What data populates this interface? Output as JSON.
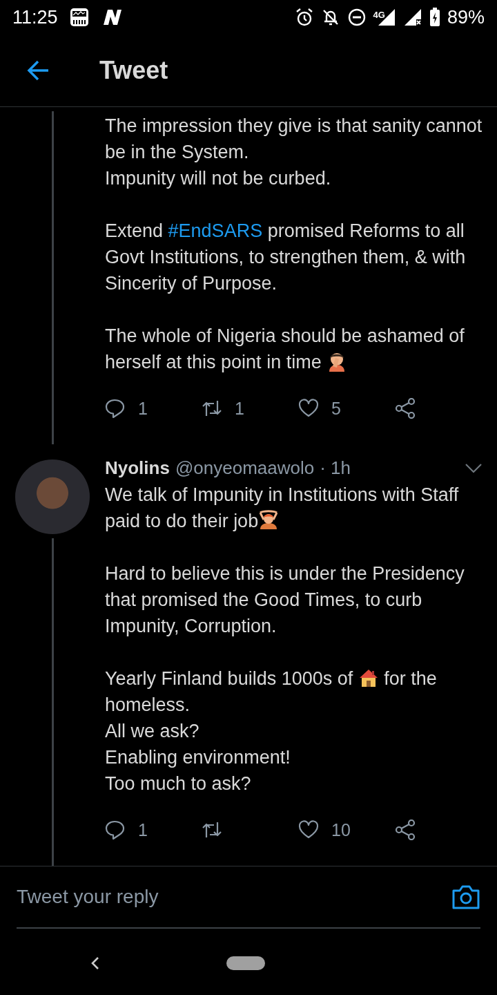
{
  "status_bar": {
    "time": "11:25",
    "battery": "89%",
    "network": "4G"
  },
  "header": {
    "title": "Tweet"
  },
  "tweets": [
    {
      "paragraphs": [
        [
          [
            {
              "kind": "text",
              "text": "The impression they give is that sanity cannot be in the System."
            }
          ],
          [
            {
              "kind": "text",
              "text": "Impunity will not be curbed."
            }
          ]
        ],
        [
          [
            {
              "kind": "text",
              "text": "Extend "
            },
            {
              "kind": "hashtag",
              "text": "#EndSARS"
            },
            {
              "kind": "text",
              "text": " promised Reforms to all Govt Institutions, to strengthen them, & with Sincerity of Purpose."
            }
          ]
        ],
        [
          [
            {
              "kind": "text",
              "text": "The whole of Nigeria should be ashamed of herself at this point in time "
            },
            {
              "kind": "emoji-facepalm"
            }
          ]
        ]
      ],
      "actions": [
        {
          "kind": "reply",
          "count": "1"
        },
        {
          "kind": "retweet",
          "count": "1"
        },
        {
          "kind": "like",
          "count": "5"
        },
        {
          "kind": "share"
        }
      ]
    },
    {
      "author": {
        "name": "Nyolins",
        "handle": "@onyeomaawolo",
        "time": "· 1h"
      },
      "paragraphs": [
        [
          [
            {
              "kind": "text",
              "text": "We talk of Impunity in Institutions with Staff paid to do their job"
            },
            {
              "kind": "emoji-gesture"
            }
          ]
        ],
        [
          [
            {
              "kind": "text",
              "text": "Hard to believe this is under the Presidency that promised the Good Times, to curb Impunity, Corruption."
            }
          ]
        ],
        [
          [
            {
              "kind": "text",
              "text": "Yearly Finland builds 1000s of "
            },
            {
              "kind": "emoji-house"
            },
            {
              "kind": "text",
              "text": "  for the homeless."
            }
          ],
          [
            {
              "kind": "text",
              "text": "All we ask?"
            }
          ],
          [
            {
              "kind": "text",
              "text": "Enabling environment!"
            }
          ],
          [
            {
              "kind": "text",
              "text": "Too much to ask?"
            }
          ]
        ]
      ],
      "actions": [
        {
          "kind": "reply",
          "count": "1"
        },
        {
          "kind": "retweet"
        },
        {
          "kind": "like",
          "count": "10"
        },
        {
          "kind": "share"
        }
      ]
    }
  ],
  "reply_bar": {
    "placeholder": "Tweet your reply"
  }
}
